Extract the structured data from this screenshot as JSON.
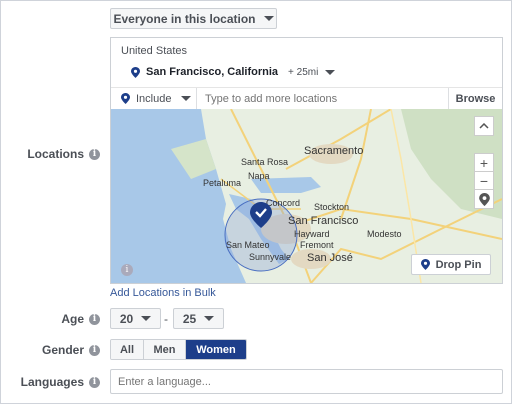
{
  "audience_type": "Everyone in this location",
  "labels": {
    "locations": "Locations",
    "age": "Age",
    "gender": "Gender",
    "languages": "Languages"
  },
  "location": {
    "country": "United States",
    "city": "San Francisco, California",
    "radius": "+ 25mi",
    "include_label": "Include",
    "search_placeholder": "Type to add more locations",
    "browse_label": "Browse",
    "add_bulk_label": "Add Locations in Bulk",
    "drop_pin_label": "Drop Pin"
  },
  "map": {
    "cities": [
      "Sacramento",
      "Santa Rosa",
      "Napa",
      "Petaluma",
      "Concord",
      "Stockton",
      "San Francisco",
      "Hayward",
      "Modesto",
      "San Mateo",
      "Fremont",
      "Sunnyvale",
      "San José"
    ]
  },
  "age": {
    "min": "20",
    "separator": "-",
    "max": "25"
  },
  "gender": {
    "options": [
      "All",
      "Men",
      "Women"
    ],
    "selected": "Women"
  },
  "languages": {
    "placeholder": "Enter a language..."
  },
  "colors": {
    "accent": "#1d3e8a",
    "link": "#365899"
  }
}
